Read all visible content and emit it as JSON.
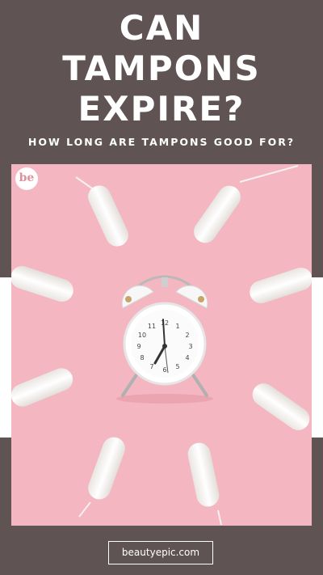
{
  "header": {
    "title_line1": "CAN",
    "title_line2": "TAMPONS",
    "title_line3": "EXPIRE?",
    "subtitle": "HOW LONG ARE TAMPONS GOOD FOR?"
  },
  "photo": {
    "logo_text": "be",
    "background_color": "#f4b6c0",
    "subject": "alarm-clock-with-tampons-icon"
  },
  "clock": {
    "numbers": [
      "12",
      "1",
      "2",
      "3",
      "4",
      "5",
      "6",
      "7",
      "8",
      "9",
      "10",
      "11"
    ]
  },
  "footer": {
    "site_label": "beautyepic.com"
  },
  "colors": {
    "background": "#5f5453",
    "pink": "#f4b6c0",
    "text": "#ffffff"
  }
}
